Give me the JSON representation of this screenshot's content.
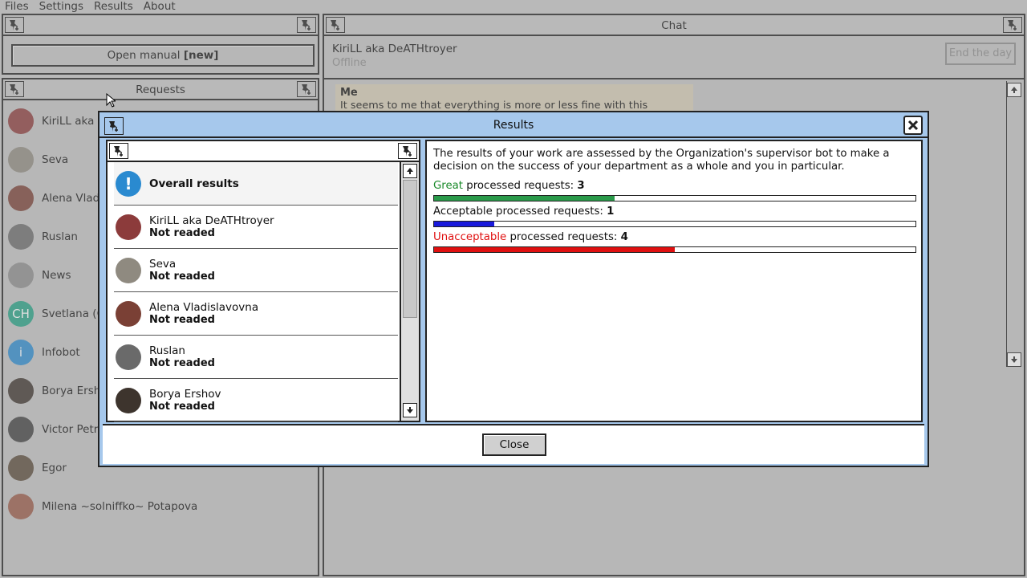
{
  "menu": [
    "Files",
    "Settings",
    "Results",
    "About"
  ],
  "manual_panel": {
    "button_label": "Open manual",
    "button_badge": "[new]"
  },
  "requests_panel": {
    "title": "Requests",
    "items": [
      {
        "name": "KiriLL aka DeATHtroyer",
        "avatar": "red-hair-avatar",
        "color": "#8c3b3b"
      },
      {
        "name": "Seva",
        "avatar": "old-man-avatar",
        "color": "#8f8a80"
      },
      {
        "name": "Alena Vladislavovna",
        "avatar": "woman-avatar",
        "color": "#7a4035"
      },
      {
        "name": "Ruslan",
        "avatar": "cap-man-avatar",
        "color": "#6a6a6a"
      },
      {
        "name": "News",
        "avatar": "news-icon",
        "color": "#8d8d8d"
      },
      {
        "name": "Svetlana (C",
        "avatar_text": "CH",
        "color": "#24a184"
      },
      {
        "name": "Infobot",
        "avatar": "info-icon",
        "avatar_text": "i",
        "color": "#2a8ad0"
      },
      {
        "name": "Borya Ershov",
        "avatar": "dark-hair-avatar",
        "color": "#3d342d"
      },
      {
        "name": "Victor Petrov",
        "avatar": "dark-man-avatar",
        "color": "#3f3f3f"
      },
      {
        "name": "Egor",
        "avatar": "egor-avatar",
        "color": "#5a4a3a"
      },
      {
        "name": "Milena ~solniffko~ Potapova",
        "avatar": "milena-avatar",
        "color": "#9a5a48"
      }
    ]
  },
  "chat_panel": {
    "title": "Chat",
    "contact_name": "KiriLL aka DeATHtroyer",
    "contact_status": "Offline",
    "end_day_label": "End the day",
    "bubble_author": "Me",
    "bubble_text": "It seems to me that everything is more or less fine with this modification and its development history. The minor quirks are more"
  },
  "results_dialog": {
    "title": "Results",
    "list": [
      {
        "name": "Overall results",
        "status": "",
        "avatar": "exclamation-icon",
        "color": "#2a8ad0"
      },
      {
        "name": "KiriLL aka DeATHtroyer",
        "status": "Not readed",
        "color": "#8c3b3b"
      },
      {
        "name": "Seva",
        "status": "Not readed",
        "color": "#8f8a80"
      },
      {
        "name": "Alena Vladislavovna",
        "status": "Not readed",
        "color": "#7a4035"
      },
      {
        "name": "Ruslan",
        "status": "Not readed",
        "color": "#6a6a6a"
      },
      {
        "name": "Borya Ershov",
        "status": "Not readed",
        "color": "#3d342d"
      }
    ],
    "description": "The results of your work are assessed by the Organization's supervisor bot to make a decision on the success of your department as a whole and you in particular.",
    "stats": [
      {
        "label_colored": "Great",
        "label_rest": " processed requests: ",
        "value": "3",
        "label_color": "#1a8a2a",
        "fraction": 0.375,
        "bar_color": "#2a9a4a"
      },
      {
        "label_colored": "",
        "label_rest": "Acceptable processed requests: ",
        "value": "1",
        "label_color": "#111111",
        "fraction": 0.125,
        "bar_color": "#1a1adc"
      },
      {
        "label_colored": "Unacceptable",
        "label_rest": " processed requests: ",
        "value": "4",
        "label_color": "#e01010",
        "fraction": 0.5,
        "bar_color": "#e01010"
      }
    ],
    "close_label": "Close"
  }
}
